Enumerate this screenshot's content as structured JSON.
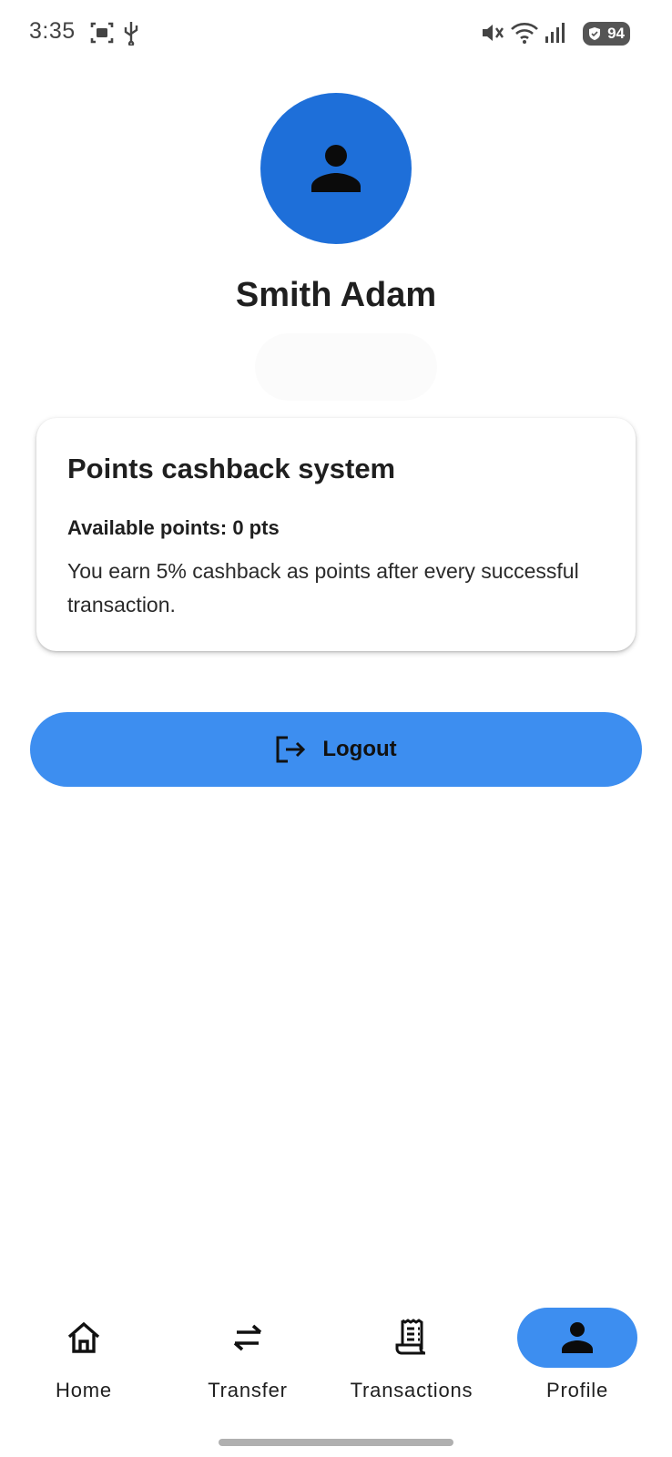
{
  "status_bar": {
    "time": "3:35",
    "battery": "94",
    "icons": [
      "screenshot-icon",
      "usb-icon",
      "mute-icon",
      "wifi-icon",
      "signal-icon",
      "battery-icon"
    ]
  },
  "profile": {
    "avatar_icon": "person-icon",
    "name": "Smith Adam"
  },
  "points_card": {
    "title": "Points cashback system",
    "available_points": "Available points: 0 pts",
    "description": "You earn 5% cashback as points after every successful transaction."
  },
  "logout": {
    "icon": "logout-icon",
    "label": "Logout"
  },
  "bottom_nav": {
    "items": [
      {
        "label": "Home",
        "icon": "home-icon"
      },
      {
        "label": "Transfer",
        "icon": "transfer-icon"
      },
      {
        "label": "Transactions",
        "icon": "receipt-icon"
      },
      {
        "label": "Profile",
        "icon": "person-icon",
        "active": true
      }
    ]
  },
  "colors": {
    "avatar_bg": "#1e6fd9",
    "accent": "#3d8ef0"
  }
}
